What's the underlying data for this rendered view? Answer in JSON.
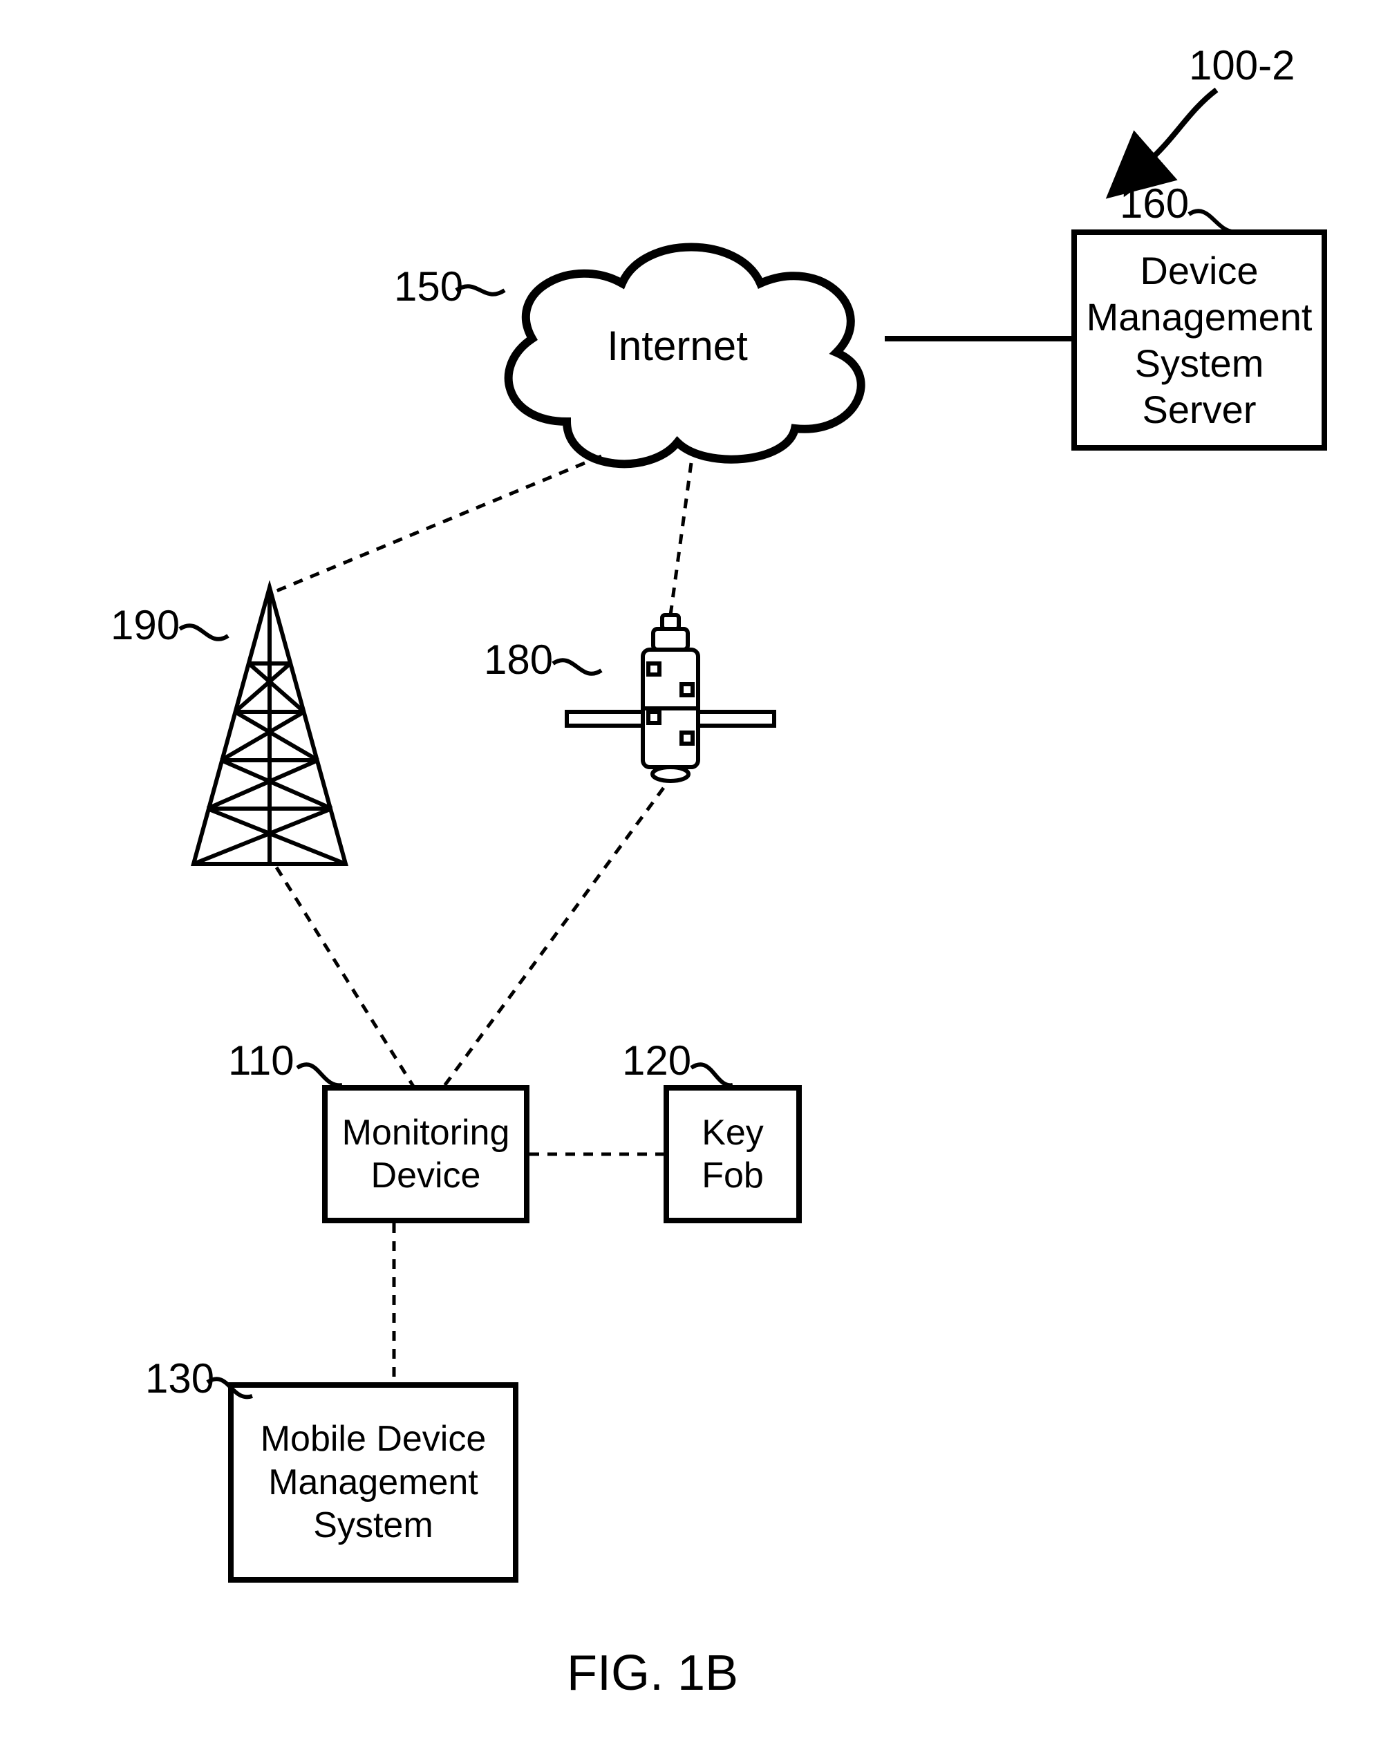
{
  "figure_label": "FIG. 1B",
  "diagram_ref": "100-2",
  "nodes": {
    "internet": {
      "ref": "150",
      "label": "Internet"
    },
    "server": {
      "ref": "160",
      "label": "Device\nManagement\nSystem\nServer"
    },
    "tower": {
      "ref": "190"
    },
    "satellite": {
      "ref": "180"
    },
    "monitor": {
      "ref": "110",
      "label": "Monitoring\nDevice"
    },
    "keyfob": {
      "ref": "120",
      "label": "Key\nFob"
    },
    "mdms": {
      "ref": "130",
      "label": "Mobile Device\nManagement\nSystem"
    }
  }
}
